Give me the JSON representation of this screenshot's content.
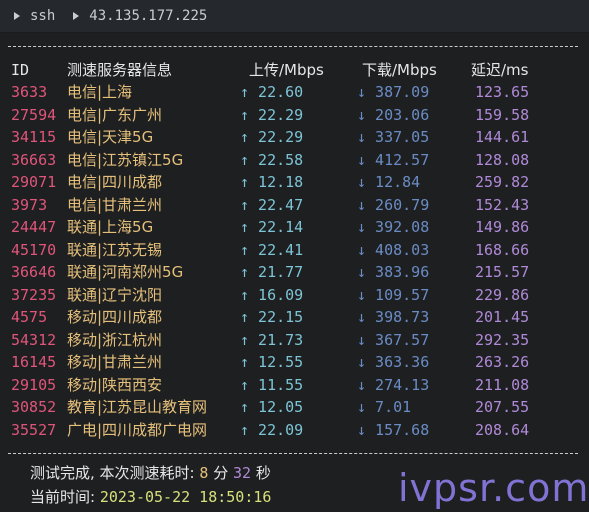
{
  "window": {
    "breadcrumb": [
      "ssh",
      "43.135.177.225"
    ]
  },
  "header": {
    "id": "ID",
    "server": "测速服务器信息",
    "upload": "上传/Mbps",
    "download": "下载/Mbps",
    "latency": "延迟/ms"
  },
  "rows": [
    {
      "id": "3633",
      "server": "电信|上海",
      "upload": "↑ 22.60",
      "download": "↓ 387.09",
      "latency": "123.65"
    },
    {
      "id": "27594",
      "server": "电信|广东广州",
      "upload": "↑ 22.29",
      "download": "↓ 203.06",
      "latency": "159.58"
    },
    {
      "id": "34115",
      "server": "电信|天津5G",
      "upload": "↑ 22.29",
      "download": "↓ 337.05",
      "latency": "144.61"
    },
    {
      "id": "36663",
      "server": "电信|江苏镇江5G",
      "upload": "↑ 22.58",
      "download": "↓ 412.57",
      "latency": "128.08"
    },
    {
      "id": "29071",
      "server": "电信|四川成都",
      "upload": "↑ 12.18",
      "download": "↓ 12.84",
      "latency": "259.82"
    },
    {
      "id": "3973",
      "server": "电信|甘肃兰州",
      "upload": "↑ 22.47",
      "download": "↓ 260.79",
      "latency": "152.43"
    },
    {
      "id": "24447",
      "server": "联通|上海5G",
      "upload": "↑ 22.14",
      "download": "↓ 392.08",
      "latency": "149.86"
    },
    {
      "id": "45170",
      "server": "联通|江苏无锡",
      "upload": "↑ 22.41",
      "download": "↓ 408.03",
      "latency": "168.66"
    },
    {
      "id": "36646",
      "server": "联通|河南郑州5G",
      "upload": "↑ 21.77",
      "download": "↓ 383.96",
      "latency": "215.57"
    },
    {
      "id": "37235",
      "server": "联通|辽宁沈阳",
      "upload": "↑ 16.09",
      "download": "↓ 109.57",
      "latency": "229.86"
    },
    {
      "id": "4575",
      "server": "移动|四川成都",
      "upload": "↑ 22.15",
      "download": "↓ 398.73",
      "latency": "201.45"
    },
    {
      "id": "54312",
      "server": "移动|浙江杭州",
      "upload": "↑ 21.73",
      "download": "↓ 367.57",
      "latency": "292.35"
    },
    {
      "id": "16145",
      "server": "移动|甘肃兰州",
      "upload": "↑ 12.55",
      "download": "↓ 363.36",
      "latency": "263.26"
    },
    {
      "id": "29105",
      "server": "移动|陕西西安",
      "upload": "↑ 11.55",
      "download": "↓ 274.13",
      "latency": "211.08"
    },
    {
      "id": "30852",
      "server": "教育|江苏昆山教育网",
      "upload": "↑ 12.05",
      "download": "↓ 7.01",
      "latency": "207.55"
    },
    {
      "id": "35527",
      "server": "广电|四川成都广电网",
      "upload": "↑ 22.09",
      "download": "↓ 157.68",
      "latency": "208.64"
    }
  ],
  "footer": {
    "done_prefix": "测试完成, 本次测速耗时:",
    "minutes": "8",
    "min_unit": "分",
    "seconds": "32",
    "sec_unit": "秒",
    "time_label": "当前时间:",
    "time_value": "2023-05-22 18:50:16"
  },
  "watermark": "ivpsr.com",
  "colors": {
    "background": "#1e1f21",
    "id": "#e0557a",
    "server": "#e5c07b",
    "upload": "#7dc4d6",
    "download": "#6a8cc4",
    "latency": "#b08ad8"
  }
}
